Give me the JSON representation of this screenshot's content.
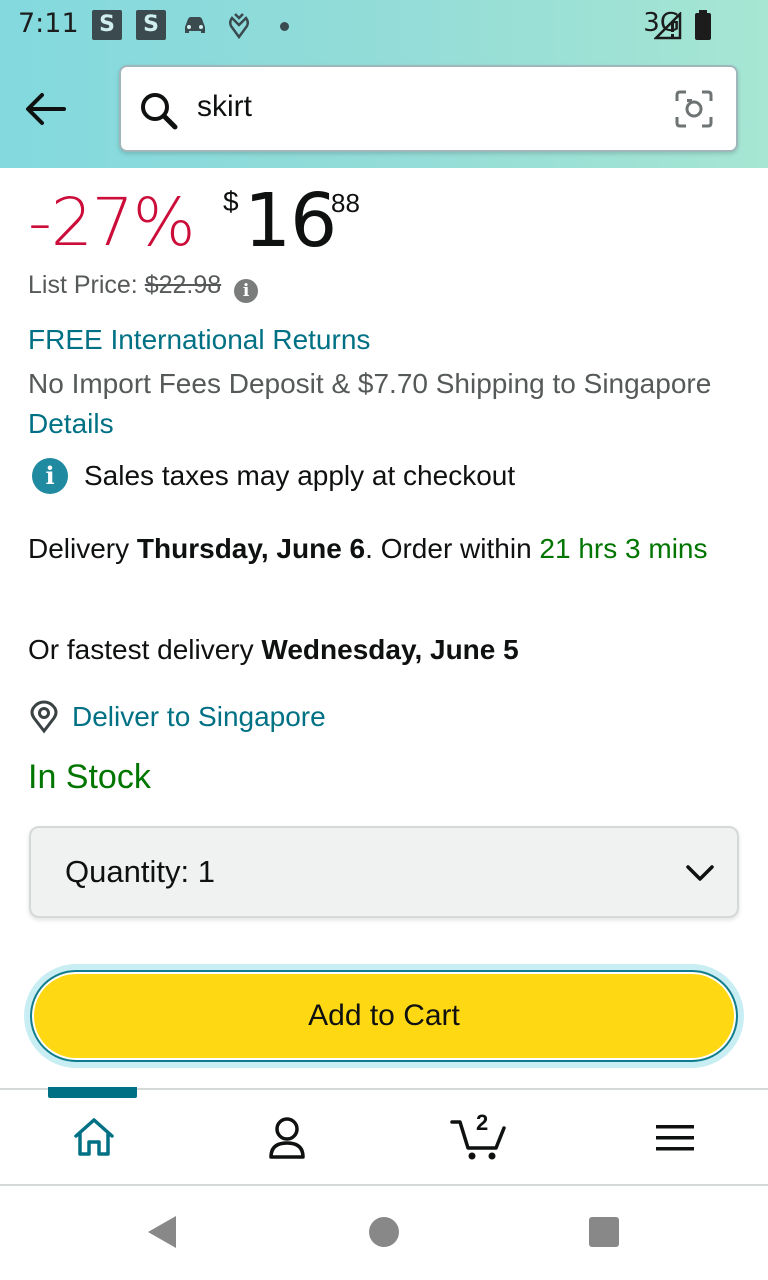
{
  "status_bar": {
    "time": "7:11",
    "badge_1": "S",
    "badge_2": "S",
    "network": "3G"
  },
  "search": {
    "query": "skirt",
    "icons": [
      "back-arrow-icon",
      "search-icon",
      "camera-scan-icon"
    ]
  },
  "price": {
    "discount": "-27%",
    "currency": "$",
    "whole": "16",
    "fraction": "88",
    "list_price_label": "List Price:",
    "list_price_value": "$22.98"
  },
  "shipping": {
    "returns": "FREE International Returns",
    "import_text": "No Import Fees Deposit & $7.70 Shipping to Singapore",
    "details_link": "Details",
    "tax_note": "Sales taxes may apply at checkout"
  },
  "delivery": {
    "prefix": "Delivery",
    "date": "Thursday, June 6",
    "order_within_prefix": ". Order within",
    "countdown": "21 hrs 3 mins",
    "fastest_prefix": "Or fastest delivery",
    "fastest_date": "Wednesday, June 5",
    "deliver_to": "Deliver to Singapore"
  },
  "stock": {
    "status": "In Stock"
  },
  "quantity": {
    "label": "Quantity:",
    "value": "1"
  },
  "actions": {
    "add_to_cart": "Add to Cart"
  },
  "bottom_nav": {
    "cart_count": "2",
    "items": [
      "home-icon",
      "account-icon",
      "cart-icon",
      "menu-icon"
    ]
  },
  "colors": {
    "discount_red": "#cc0c39",
    "link_teal": "#007185",
    "stock_green": "#007600",
    "cart_button_yellow": "#ffd814"
  }
}
